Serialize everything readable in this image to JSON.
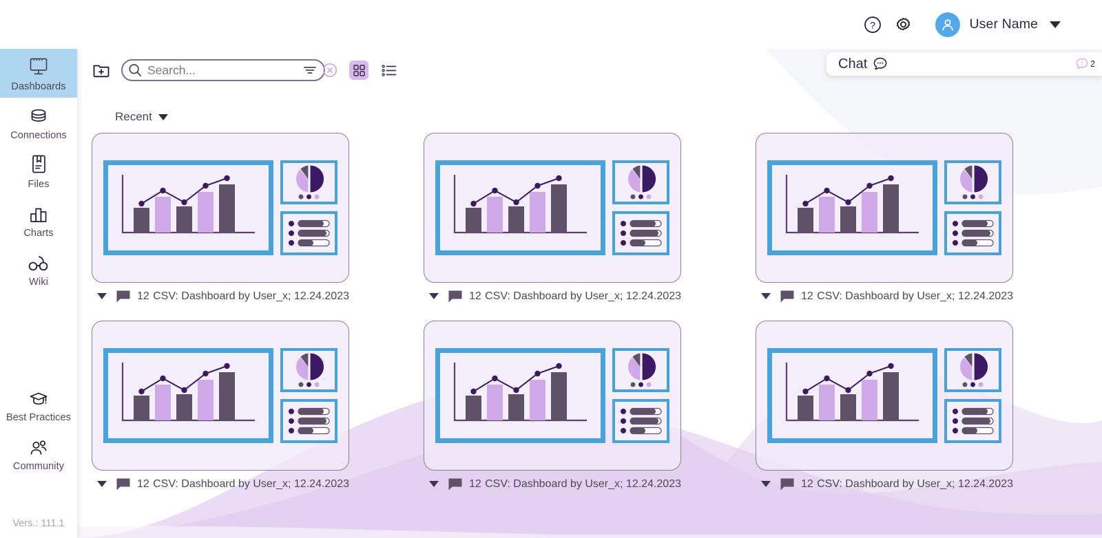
{
  "header": {
    "help_icon": "help-circle-icon",
    "settings_icon": "gear-icon",
    "avatar_icon": "user-avatar-icon",
    "user_name": "User Name",
    "dropdown_icon": "chevron-down-icon"
  },
  "sidebar": {
    "items": [
      {
        "label": "Dashboards",
        "icon": "dashboard-monitor-icon",
        "active": true
      },
      {
        "label": "Connections",
        "icon": "database-icon",
        "active": false
      },
      {
        "label": "Files",
        "icon": "file-bookmark-icon",
        "active": false
      },
      {
        "label": "Charts",
        "icon": "bar-chart-icon",
        "active": false
      },
      {
        "label": "Wiki",
        "icon": "glasses-icon",
        "active": false
      }
    ],
    "bottom_items": [
      {
        "label": "Best Practices",
        "icon": "graduation-cap-icon"
      },
      {
        "label": "Community",
        "icon": "people-group-icon"
      }
    ],
    "version": "Vers.: 111.1"
  },
  "toolbar": {
    "new_folder_icon": "folder-plus-icon",
    "search": {
      "placeholder": "Search...",
      "value": "",
      "search_icon": "search-icon",
      "filter_icon": "filter-icon",
      "clear_icon": "clear-circle-icon"
    },
    "grid_view_icon": "grid-view-icon",
    "list_view_icon": "list-view-icon",
    "active_view": "grid"
  },
  "chat": {
    "title": "Chat",
    "bubble_icon": "chat-bubble-icon",
    "alert_icon": "alert-bubble-icon",
    "count": "2"
  },
  "sort": {
    "label": "Recent",
    "caret_icon": "caret-down-icon"
  },
  "cards": [
    {
      "comments": "12",
      "title": "CSV: Dashboard by User_x; 12.24.2023"
    },
    {
      "comments": "12",
      "title": "CSV: Dashboard by User_x; 12.24.2023"
    },
    {
      "comments": "12",
      "title": "CSV: Dashboard by User_x; 12.24.2023"
    },
    {
      "comments": "12",
      "title": "CSV: Dashboard by User_x; 12.24.2023"
    },
    {
      "comments": "12",
      "title": "CSV: Dashboard by User_x; 12.24.2023"
    },
    {
      "comments": "12",
      "title": "CSV: Dashboard by User_x; 12.24.2023"
    }
  ],
  "colors": {
    "accent_blue": "#46a3de",
    "active_nav": "#aed6f1",
    "card_bg": "#f3eafa",
    "dark_purple": "#3c1a63",
    "light_purple": "#cfa9e8",
    "gray_purple": "#5f5268",
    "avatar_blue": "#52a8e8",
    "toggle_active": "#d9b9ee",
    "wave_purple": "#e6d3f1"
  },
  "thumbnail_chart": {
    "type": "bar",
    "bars": [
      30,
      58,
      33,
      68,
      85
    ],
    "bar_colors": [
      "#5f5268",
      "#cfa9e8",
      "#5f5268",
      "#cfa9e8",
      "#5f5268"
    ],
    "line_points": [
      22,
      55,
      30,
      70,
      92
    ],
    "pie_slices": [
      50,
      36,
      14
    ],
    "pie_colors": [
      "#3c1a63",
      "#cfa9e8",
      "#5f5268"
    ],
    "legend_dots": [
      "#5f5268",
      "#3c1a63",
      "#cfa9e8"
    ],
    "progress_bars": [
      82,
      92,
      48
    ]
  }
}
